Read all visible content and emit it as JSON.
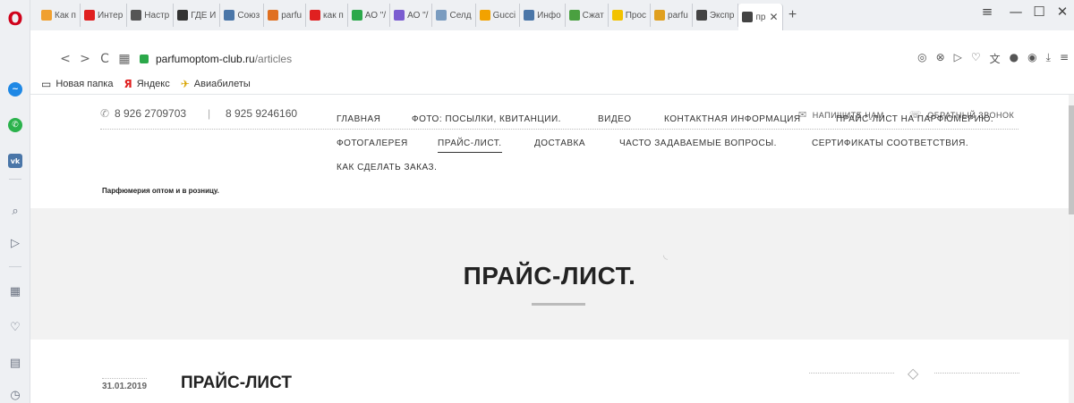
{
  "browser": {
    "tabs": [
      {
        "label": "Как п",
        "color": "#f0a030"
      },
      {
        "label": "Интер",
        "color": "#e02020"
      },
      {
        "label": "Настр",
        "color": "#555555"
      },
      {
        "label": "ГДЕ И",
        "color": "#333333"
      },
      {
        "label": "Союз",
        "color": "#4a76a8"
      },
      {
        "label": "parfu",
        "color": "#e07020"
      },
      {
        "label": "как п",
        "color": "#e02020"
      },
      {
        "label": "АО \"/",
        "color": "#2ba84a"
      },
      {
        "label": "АО \"/",
        "color": "#7a5cd0"
      },
      {
        "label": "Селд",
        "color": "#7a9cc0"
      },
      {
        "label": "Gucci",
        "color": "#f2a200"
      },
      {
        "label": "Инфо",
        "color": "#4a76a8"
      },
      {
        "label": "Сжат",
        "color": "#4aa040"
      },
      {
        "label": "Прос",
        "color": "#f2c200"
      },
      {
        "label": "parfu",
        "color": "#e0a020"
      },
      {
        "label": "Экспр",
        "color": "#444444"
      }
    ],
    "active_tab": {
      "label": "пр",
      "close": "✕"
    },
    "new_tab": "+",
    "url_host": "parfumoptom-club.ru",
    "url_path": "/articles",
    "bookmarks": [
      {
        "label": "Новая папка",
        "icon": "folder-icon"
      },
      {
        "label": "Яндекс",
        "icon": "yandex-icon"
      },
      {
        "label": "Авиабилеты",
        "icon": "plane-icon"
      }
    ]
  },
  "site": {
    "phone1": "8 926 2709703",
    "phone_sep": "|",
    "phone2": "8 925 9246160",
    "write_us": "НАПИШИТЕ НАМ",
    "callback": "ОБРАТНЫЙ ЗВОНОК",
    "brand": "Парфюмерия оптом и в розницу.",
    "menu": [
      "ГЛАВНАЯ",
      "ФОТО: ПОСЫЛКИ, КВИТАНЦИИ.",
      "ВИДЕО",
      "КОНТАКТНАЯ ИНФОРМАЦИЯ",
      "ПРАЙС-ЛИСТ НА ПАРФЮМЕРИЮ.",
      "ФОТОГАЛЕРЕЯ",
      "ПРАЙС-ЛИСТ.",
      "ДОСТАВКА",
      "ЧАСТО ЗАДАВАЕМЫЕ ВОПРОСЫ.",
      "СЕРТИФИКАТЫ СООТВЕТСТВИЯ.",
      "КАК СДЕЛАТЬ ЗАКАЗ."
    ],
    "page_title": "ПРАЙС-ЛИСТ.",
    "post_date": "31.01.2019",
    "post_title": "ПРАЙС-ЛИСТ"
  }
}
